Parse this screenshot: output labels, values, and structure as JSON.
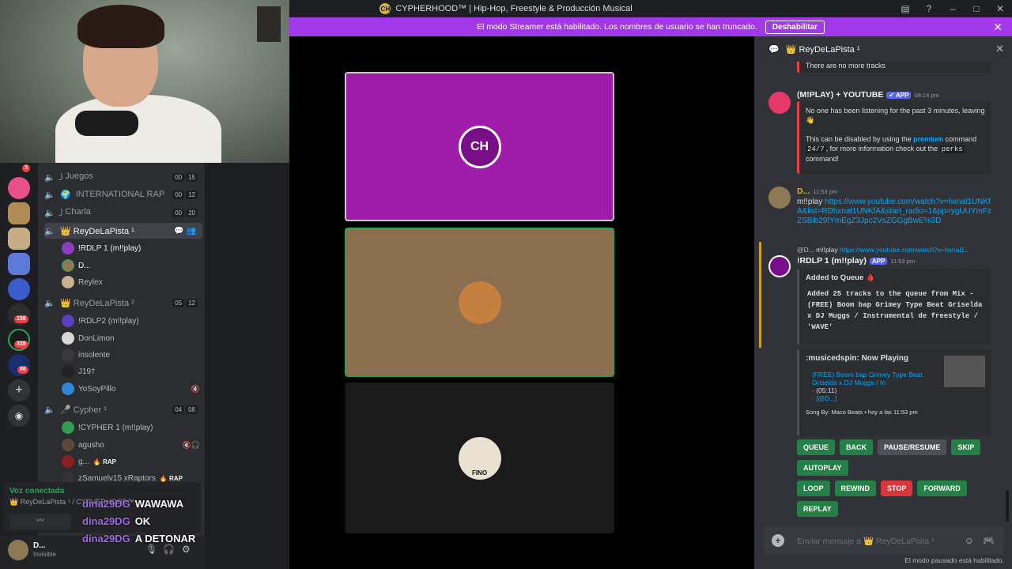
{
  "window": {
    "title": "CYPHERHOOD™ | Hip-Hop, Freestyle & Producción Musical",
    "logo_text": "CH"
  },
  "banner": {
    "text": "El modo Streamer está habilitado. Los nombres de usuario se han truncado.",
    "button": "Deshabilitar"
  },
  "rail": {
    "badges": [
      "3",
      "158",
      "338",
      "86"
    ]
  },
  "channels": [
    {
      "name": "꠸ Juegos",
      "icon": "🎮",
      "counts": [
        "00",
        "15"
      ]
    },
    {
      "name": "INTERNATIONAL RAP",
      "icon": "🌍",
      "counts": [
        "00",
        "12"
      ]
    },
    {
      "name": "꠸ Charla",
      "icon": "💬",
      "counts": [
        "00",
        "20"
      ]
    },
    {
      "name": "👑 ReyDeLaPista ¹",
      "icon": "",
      "counts": []
    },
    {
      "name": "👑 ReyDeLaPista ²",
      "icon": "",
      "counts": [
        "05",
        "12"
      ]
    },
    {
      "name": "🎤 Cypher ¹",
      "icon": "",
      "counts": [
        "04",
        "08"
      ]
    }
  ],
  "users_rey1": [
    "!RDLP 1 (m!!play)",
    "D...",
    "Reylex"
  ],
  "users_rey2": [
    "!RDLP2 (m!!play)",
    "DonLimon",
    "insolente",
    "J19†",
    "YoSoyPillo"
  ],
  "users_cypher": [
    "!CYPHER 1 (m!!play)",
    "agusho",
    "g...",
    "zSamuelv15 xRaptors"
  ],
  "rap_tag": "🔥 RAP",
  "voice": {
    "status": "Voz conectada",
    "location": "👑 ReyDeLaPista ¹ / CYPHERHOOD™"
  },
  "user": {
    "name": "D...",
    "status": "Invisible"
  },
  "stream_chat": [
    {
      "who": "dina29DG",
      "msg": "WAWAWA"
    },
    {
      "who": "dina29DG",
      "msg": "OK"
    },
    {
      "who": "dina29DG",
      "msg": "A DETONAR"
    }
  ],
  "stage": {
    "tile3_label": "FINO"
  },
  "rpanel": {
    "title": "👑 ReyDeLaPista ¹",
    "top_snippet": "There are no more tracks",
    "msg1": {
      "author": "(M!PLAY) + YOUTUBE",
      "tag": "✔ APP",
      "time": "09:14 pm",
      "line1": "No one has been listening for the past 3 minutes, leaving 👋",
      "line2_a": "This can be disabled by using the ",
      "premium": "premium",
      "line2_b": " command",
      "code1": "24/7",
      "line3": ", for more information check out the ",
      "code2": "perks",
      "line4": "command!"
    },
    "msg2": {
      "author": "D...",
      "time": "11:53 pm",
      "cmd": "m!!play",
      "url": "https://www.youtube.com/watch?v=hxnal1UNKfA&list=RDhxnal1UNKfA&start_radio=1&pp=ygUUYmFzZSBib29tYmEgZ3Jpc2VsZGGgBwE%3D"
    },
    "msg3": {
      "reply_user": "@D...",
      "reply_cmd": "m!!play",
      "reply_url": "https://www.youtube.com/watch?v=hxnal1...",
      "author": "!RDLP 1 (m!!play)",
      "tag": "APP",
      "time": "11:53 pm",
      "embed_title": "Added to Queue 🩸",
      "embed_body": "Added 25 tracks to the queue from Mix - (FREE) Boom bap Grimey Type Beat Griselda x DJ Muggs / Instrumental de freestyle / 'WAVE'"
    },
    "now_playing": {
      "title": ":musicedspin: Now Playing",
      "track": "(FREE) Boom bap Grimey Type Beat Griselda x DJ Muggs / In",
      "duration": "· (05:11)",
      "requester": "· [@D...]",
      "footer": "Song By: Maco Beats • hoy a las 11:53 pm"
    },
    "buttons_row1": [
      "QUEUE",
      "BACK",
      "PAUSE/RESUME",
      "SKIP"
    ],
    "buttons_row2": [
      "AUTOPLAY"
    ],
    "buttons_row3": [
      "LOOP",
      "REWIND",
      "STOP",
      "FORWARD"
    ],
    "buttons_row4": [
      "REPLAY"
    ],
    "composer_placeholder": "Enviar mensaje a 👑 ReyDeLaPista ¹",
    "paused_note": "El modo pausado está habilitado."
  }
}
